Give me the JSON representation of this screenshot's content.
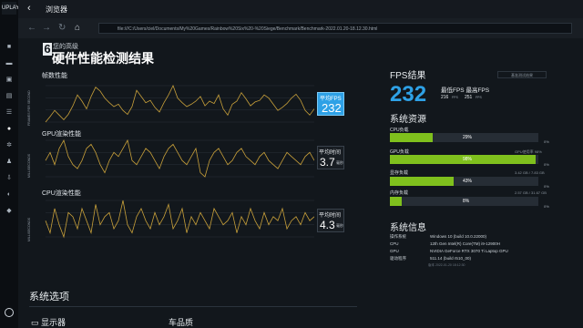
{
  "app": {
    "title": "浏览器",
    "logo_text": "UPLAY"
  },
  "nav": {
    "back": "←",
    "forward": "→",
    "refresh": "↻",
    "home": "⌂",
    "url": "file:///C:/Users/ciel/Documents/My%20Games/Rainbow%20Six%20-%20Siege/Benchmark/Benchmark-2022.01.20-18.12.30.html"
  },
  "header": {
    "subtitle": "您的高级",
    "title": "硬件性能检测结果",
    "logo_char": "6"
  },
  "charts": {
    "fps": {
      "label": "帧数性能",
      "axis_label": "FRAMES PER SECOND"
    },
    "gpu": {
      "label": "GPU渲染性能",
      "axis_label": "MILLISECONDS"
    },
    "cpu": {
      "label": "CPU渲染性能",
      "axis_label": "MILLISECONDS"
    }
  },
  "chart_data": [
    {
      "type": "line",
      "title": "帧数性能",
      "series": [
        {
          "values": [
            205,
            212,
            220,
            214,
            208,
            215,
            226,
            240,
            232,
            222,
            238,
            250,
            245,
            236,
            230,
            225,
            228,
            220,
            215,
            225,
            246,
            238,
            230,
            233,
            224,
            218,
            230,
            240,
            252,
            236,
            230,
            225,
            228,
            232,
            238,
            226,
            232,
            229,
            240,
            222,
            214,
            228,
            232,
            243,
            235,
            226,
            231,
            233,
            240,
            236,
            228,
            220,
            224,
            229,
            236,
            241,
            233,
            220,
            214,
            222
          ]
        }
      ]
    },
    {
      "type": "line",
      "title": "GPU渲染性能",
      "series": [
        {
          "values": [
            3.6,
            3.8,
            3.5,
            3.9,
            4.1,
            3.7,
            3.5,
            3.4,
            3.6,
            3.9,
            4.0,
            3.8,
            3.5,
            3.3,
            3.6,
            3.8,
            3.7,
            3.9,
            4.1,
            3.6,
            3.5,
            3.7,
            3.9,
            3.8,
            3.6,
            3.4,
            3.7,
            3.9,
            4.0,
            3.8,
            3.6,
            3.5,
            3.7,
            3.9,
            3.3,
            3.2,
            3.6,
            3.8,
            3.9,
            3.7,
            3.5,
            3.6,
            3.8,
            3.9,
            3.7,
            3.6,
            3.5,
            3.7,
            3.8,
            3.6,
            3.5,
            3.4,
            3.6,
            3.8,
            3.7,
            3.6,
            3.5,
            3.7,
            3.8,
            3.6
          ]
        }
      ]
    },
    {
      "type": "line",
      "title": "CPU渲染性能",
      "series": [
        {
          "values": [
            4.3,
            4.0,
            4.6,
            4.2,
            3.9,
            4.5,
            4.4,
            4.1,
            4.6,
            4.3,
            4.0,
            4.7,
            4.2,
            4.4,
            4.5,
            4.1,
            4.3,
            4.8,
            4.2,
            4.0,
            4.4,
            4.6,
            4.3,
            4.1,
            4.5,
            4.2,
            4.4,
            4.7,
            4.1,
            4.3,
            4.6,
            4.0,
            4.4,
            4.2,
            4.5,
            4.3,
            4.1,
            4.6,
            4.4,
            4.2,
            4.3,
            4.5,
            4.0,
            4.4,
            4.2,
            4.6,
            4.3,
            4.1,
            4.5,
            4.2,
            4.4,
            4.3,
            4.6,
            4.1,
            4.3,
            4.4,
            4.2,
            4.5,
            4.3,
            4.4
          ]
        }
      ]
    }
  ],
  "stats": {
    "avg_fps_label": "平均FPS",
    "avg_fps": "232",
    "avg_time_label": "平均时间",
    "gpu_avg": "3.7",
    "cpu_avg": "4.3",
    "unit_ms": "毫秒"
  },
  "results": {
    "fps_title": "FPS结果",
    "fps": "232",
    "minmax_label": "最低FPS 最高FPS",
    "min": "216",
    "max": "251",
    "unit": "FPS",
    "small_button": "基准测试结果"
  },
  "resources": {
    "title": "系统资源",
    "items": [
      {
        "label": "CPU负载",
        "pct": "29%",
        "fill": 0.29,
        "right": ""
      },
      {
        "label": "GPU负载",
        "pct": "98%",
        "fill": 0.98,
        "right": "GPU使用率  98%"
      },
      {
        "label": "显存负载",
        "pct": "43%",
        "fill": 0.43,
        "right": "3.42 GB / 7.83 GB"
      },
      {
        "label": "内存负载",
        "pct": "8%",
        "fill": 0.08,
        "right": "2.57 GB / 31.67 GB"
      }
    ],
    "zero": "0%"
  },
  "sysinfo": {
    "title": "系统信息",
    "rows": [
      {
        "k": "操作系统",
        "v": "Windows 10 (build 10.0.22000)"
      },
      {
        "k": "CPU",
        "v": "12th Gen Intel(R) Core(TM) i9-12900H"
      },
      {
        "k": "GPU",
        "v": "NVIDIA GeForce RTX 3070 Ti Laptop GPU"
      },
      {
        "k": "驱动程序",
        "v": "511.14 (build r510_00)"
      }
    ],
    "meta": "版本  2022-01-20 18:12:30"
  },
  "options": {
    "title": "系统选项",
    "display": "显示器",
    "quality": "车品质"
  }
}
